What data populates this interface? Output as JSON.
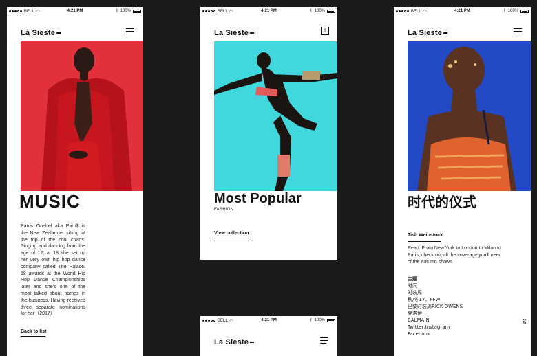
{
  "status": {
    "carrier": "BELL",
    "time": "4:21 PM",
    "battery": "100%"
  },
  "brand": "La Sieste",
  "screen1": {
    "heading": "MUSIC",
    "body": "Parris Goebel aka Parri$ is the New Zealander sitting at the top of the cool charts. Singing and dancing from the age of 12, at 18 she set up her very own hip hop dance company called The Palace. 18 awards at the World Hip Hop Dance Championships later and she's one of the most talked about names in the business. Having received three separate nominations for her（2017）",
    "link": "Back to list",
    "photo_color": "#e3313c"
  },
  "screen2": {
    "heading": "Most Popular",
    "subheading": "FASHION",
    "link": "View collection",
    "photo_color": "#41d8dd"
  },
  "screen3": {
    "heading": "时代的仪式",
    "author": "Tish Weinstock",
    "read": "Read: From New York to London to Milan to Paris, check out all the coverage you'll need of the autumn shows.",
    "tags": [
      "主题",
      "时间",
      "时装周",
      "秋/冬17，PFW",
      "巴黎时装周RICK OWENS",
      "克洛伊",
      "BALMAIN",
      "Twitter,Instagram",
      "Facebook"
    ],
    "pager": "2/5",
    "photo_color": "#2349c4"
  },
  "icons": {
    "menu": "hamburger-menu-icon",
    "expand": "plus-box-icon",
    "wifi": "wifi-icon",
    "bluetooth": "bluetooth-icon",
    "battery": "battery-icon"
  }
}
